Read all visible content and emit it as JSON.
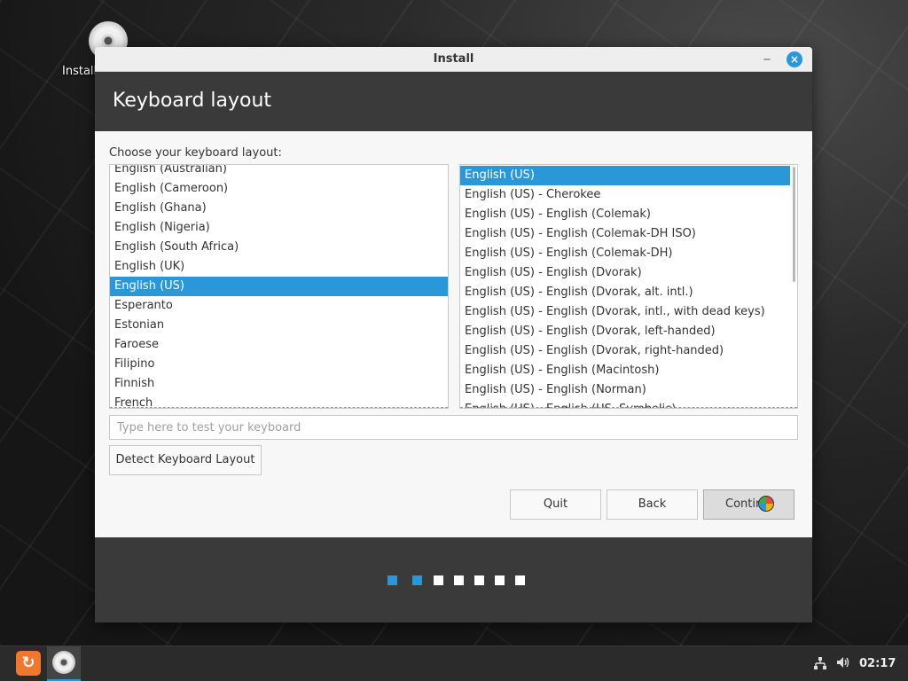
{
  "desktop": {
    "icon_label": "Install"
  },
  "window": {
    "title": "Install",
    "header": "Keyboard layout",
    "choose_label": "Choose your keyboard layout:",
    "layouts": [
      "English (Australian)",
      "English (Cameroon)",
      "English (Ghana)",
      "English (Nigeria)",
      "English (South Africa)",
      "English (UK)",
      "English (US)",
      "Esperanto",
      "Estonian",
      "Faroese",
      "Filipino",
      "Finnish",
      "French"
    ],
    "layouts_selected": "English (US)",
    "variants": [
      "English (US)",
      "English (US) - Cherokee",
      "English (US) - English (Colemak)",
      "English (US) - English (Colemak-DH ISO)",
      "English (US) - English (Colemak-DH)",
      "English (US) - English (Dvorak)",
      "English (US) - English (Dvorak, alt. intl.)",
      "English (US) - English (Dvorak, intl., with dead keys)",
      "English (US) - English (Dvorak, left-handed)",
      "English (US) - English (Dvorak, right-handed)",
      "English (US) - English (Macintosh)",
      "English (US) - English (Norman)",
      "English (US) - English (US, Symbolic)"
    ],
    "variants_selected": "English (US)",
    "test_placeholder": "Type here to test your keyboard",
    "detect_label": "Detect Keyboard Layout",
    "quit_label": "Quit",
    "back_label": "Back",
    "continue_label": "Contin",
    "progress": {
      "total_steps": 7,
      "current_step": 2
    }
  },
  "taskbar": {
    "clock": "02:17",
    "icons": [
      "menu-icon",
      "installer-disc-icon",
      "network-icon",
      "volume-icon"
    ]
  },
  "colors": {
    "accent": "#2a98d8",
    "header_bg": "#3a3a3a",
    "menu_orange": "#f0772e"
  }
}
